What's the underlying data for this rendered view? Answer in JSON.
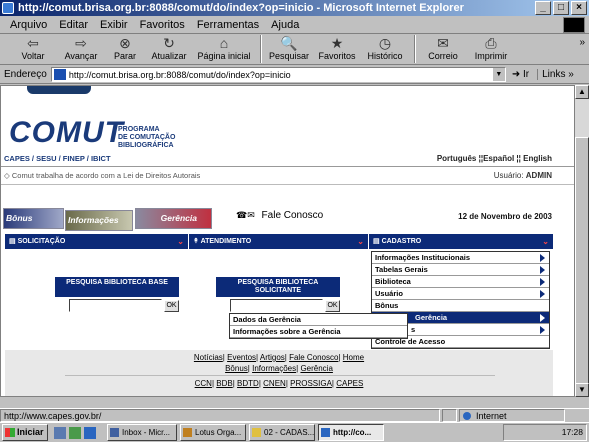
{
  "window": {
    "title": "http://comut.brisa.org.br:8088/comut/do/index?op=inicio - Microsoft Internet Explorer",
    "buttons": [
      "_",
      "□",
      "×"
    ]
  },
  "menubar": {
    "items": [
      "Arquivo",
      "Editar",
      "Exibir",
      "Favoritos",
      "Ferramentas",
      "Ajuda"
    ]
  },
  "toolbar": {
    "buttons": [
      {
        "label": "Voltar",
        "icon": "back-icon",
        "glyph": "⇦"
      },
      {
        "label": "Avançar",
        "icon": "forward-icon",
        "glyph": "⇨"
      },
      {
        "label": "Parar",
        "icon": "stop-icon",
        "glyph": "⊗"
      },
      {
        "label": "Atualizar",
        "icon": "refresh-icon",
        "glyph": "↻"
      },
      {
        "label": "Página inicial",
        "icon": "home-icon",
        "glyph": "⌂"
      },
      {
        "label": "Pesquisar",
        "icon": "search-icon",
        "glyph": "🔍"
      },
      {
        "label": "Favoritos",
        "icon": "favorites-icon",
        "glyph": "★"
      },
      {
        "label": "Histórico",
        "icon": "history-icon",
        "glyph": "◷"
      },
      {
        "label": "Correio",
        "icon": "mail-icon",
        "glyph": "✉"
      },
      {
        "label": "Imprimir",
        "icon": "print-icon",
        "glyph": "⎙"
      }
    ],
    "more": "»"
  },
  "addressbar": {
    "label": "Endereço",
    "url": "http://comut.brisa.org.br:8088/comut/do/index?op=inicio",
    "go": "Ir",
    "links": "Links »"
  },
  "page": {
    "logo_word": "COMUT",
    "program": [
      "PROGRAMA",
      "DE COMUTAÇÃO",
      "BIBLIOGRÁFICA"
    ],
    "capes_line": "CAPES / SESU / FINEP / IBICT",
    "languages": "Português ¦¦Español ¦¦ English",
    "law_text": "◇ Comut trabalha de acordo com a Lei de Direitos Autorais",
    "user_label": "Usuário:",
    "user_value": "ADMIN",
    "buttons": {
      "bonus": "Bônus",
      "informacoes": "Informações",
      "gerencia": "Gerência"
    },
    "fale_conosco": "Fale Conosco",
    "phone_glyph": "☎✉",
    "date": "12 de Novembro de 2003",
    "nav": {
      "solicitacao": "SOLICITAÇÃO",
      "atendimento": "ATENDIMENTO",
      "cadastro": "CADASTRO"
    },
    "cadastro_menu": [
      "Informações Institucionais",
      "Tabelas Gerais",
      "Biblioteca",
      "Usuário",
      "Bônus",
      "Gerência",
      "s",
      "Controle de Acesso"
    ],
    "submenu": [
      "Dados da Gerência",
      "Informações sobre a Gerência"
    ],
    "search_base": {
      "title": "PESQUISA BIBLIOTECA BASE",
      "ok": "OK",
      "value": ""
    },
    "search_solicitante": {
      "title": "PESQUISA BIBLIOTECA SOLICITANTE",
      "ok": "OK",
      "value": ""
    },
    "footer_links_1": [
      "Notícias",
      "Eventos",
      "Artigos",
      "Fale Conosco",
      "Home"
    ],
    "footer_links_2": [
      "Bônus",
      "Informações",
      "Gerência"
    ],
    "footer_links_3": [
      "CCN",
      "BDB",
      "BDTD",
      "CNEN",
      "PROSSIGA",
      "CAPES"
    ]
  },
  "statusbar": {
    "text": "http://www.capes.gov.br/",
    "zone": "Internet"
  },
  "taskbar": {
    "start": "Iniciar",
    "tasks": [
      "Inbox - Micr...",
      "Lotus Orga...",
      "02 - CADAS...",
      "http://co..."
    ],
    "clock": "17:28"
  }
}
